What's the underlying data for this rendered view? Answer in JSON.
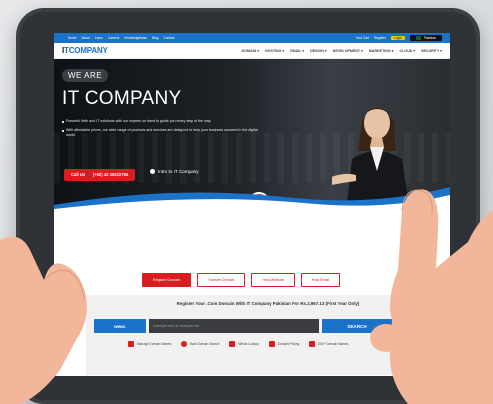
{
  "topbar": {
    "links": [
      "Home",
      "About",
      "Learn",
      "Careers",
      "Knowledgebase",
      "Blog",
      "Contact"
    ],
    "cart": "Your Cart",
    "register": "Register",
    "login": "Login",
    "country": "Pakistan"
  },
  "brand": {
    "logo_i": "I",
    "logo_rest": "TCOMPANY"
  },
  "menu": [
    "DOMAIN ▾",
    "HOSTING ▾",
    "EMAIL ▾",
    "DESIGN ▾",
    "DEVELOPMENT ▾",
    "MARKETING ▾",
    "CLOUD ▾",
    "SECURITY ▾"
  ],
  "hero": {
    "badge": "WE ARE",
    "title": "IT COMPANY",
    "bullets": [
      "Powerful Web and IT solutions with our experts on hand to guide you every step of the way.",
      "With affordable prices, our wide range of products and services are designed to help your business succeed in the digital world."
    ],
    "call_button": "Call Us 📞 (+92) 42 35222784",
    "intro_label": "Intro to IT Company"
  },
  "actions": [
    "Register Domain",
    "Transfer Domain",
    "Host Website",
    "Host Email"
  ],
  "domain": {
    "headline": "Register Your .Com Domain With IT Company Pakistan For Rs.2,967.13 (First Year Only)",
    "www_label": "www.",
    "placeholder": "example.com or example.net",
    "search_label": "SEARCH"
  },
  "tools": [
    "Manage Domain Names",
    "Bulk Domain Search",
    "Whois Lookup",
    "Domain Pricing",
    "300+ Domain Names"
  ],
  "colors": {
    "brand_blue": "#1a73c9",
    "accent_red": "#d81e1e",
    "tablet": "#3c3f44",
    "hero_dark": "#0e1217"
  }
}
